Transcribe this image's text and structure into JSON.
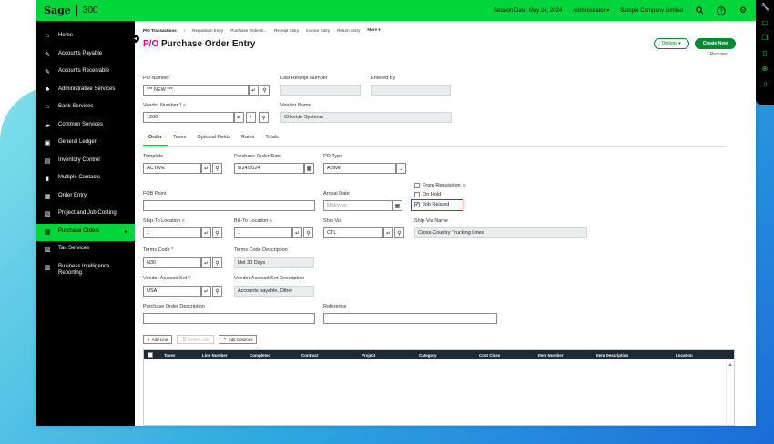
{
  "app": {
    "brand": "Sage",
    "product": "300",
    "session_date": "Session Date: May 24, 2024",
    "user": "Administrator",
    "company": "Sample Company Limited"
  },
  "sidebar": {
    "items": [
      {
        "label": "Home",
        "icon": "home-icon"
      },
      {
        "label": "Accounts Payable",
        "icon": "pen-icon"
      },
      {
        "label": "Accounts Receivable",
        "icon": "pen-icon"
      },
      {
        "label": "Administrative Services",
        "icon": "users-icon"
      },
      {
        "label": "Bank Services",
        "icon": "bank-icon"
      },
      {
        "label": "Common Services",
        "icon": "chat-icon"
      },
      {
        "label": "General Ledger",
        "icon": "ledger-icon"
      },
      {
        "label": "Inventory Control",
        "icon": "inventory-icon"
      },
      {
        "label": "Multiple Contacts",
        "icon": "contacts-icon"
      },
      {
        "label": "Order Entry",
        "icon": "order-icon"
      },
      {
        "label": "Project and Job Costing",
        "icon": "project-icon"
      },
      {
        "label": "Purchase Orders",
        "icon": "cart-icon"
      },
      {
        "label": "Tax Services",
        "icon": "tax-icon"
      },
      {
        "label": "Business Intelligence Reporting",
        "icon": "report-icon"
      }
    ]
  },
  "breadcrumb": {
    "items": [
      "P/O Transactions",
      "Requisition Entry",
      "Purchase Order E...",
      "Receipt Entry",
      "Invoice Entry",
      "Return Entry",
      "More"
    ]
  },
  "page": {
    "title_prefix": "P/O",
    "title_rest": " Purchase Order Entry",
    "options_label": "Options",
    "create_new_label": "Create New",
    "required_note": "* Required"
  },
  "form": {
    "po_number_label": "PO Number",
    "po_number_value": "*** NEW ***",
    "last_receipt_label": "Last Receipt Number",
    "entered_by_label": "Entered By",
    "vendor_number_label": "Vendor Number",
    "vendor_number_value": "1200",
    "vendor_name_label": "Vendor Name",
    "vendor_name_value": "Chloride Systems",
    "template_label": "Template",
    "template_value": "ACTIVE",
    "po_date_label": "Purchase Order Date",
    "po_date_value": "5/24/2024",
    "po_type_label": "PO Type",
    "po_type_value": "Active",
    "from_requisition_label": "From Requisition",
    "on_hold_label": "On Hold",
    "job_related_label": "Job Related",
    "fob_label": "FOB Point",
    "arrival_label": "Arrival Date",
    "arrival_placeholder": "M/d/yyyy",
    "ship_to_label": "Ship-To Location",
    "ship_to_value": "1",
    "bill_to_label": "Bill-To Location",
    "bill_to_value": "1",
    "ship_via_label": "Ship Via",
    "ship_via_value": "CTL",
    "ship_via_name_label": "Ship-Via Name",
    "ship_via_name_value": "Cross-Country Trucking Lines",
    "terms_label": "Terms Code",
    "terms_value": "N30",
    "terms_desc_label": "Terms Code Description",
    "terms_desc_value": "Net 30 Days",
    "vendor_set_label": "Vendor Account Set",
    "vendor_set_value": "USA",
    "vendor_set_desc_label": "Vendor Account Set Description",
    "vendor_set_desc_value": "Accounts payable, Other",
    "po_desc_label": "Purchase Order Description",
    "reference_label": "Reference"
  },
  "tabs": [
    "Order",
    "Taxes",
    "Optional Fields",
    "Rates",
    "Totals"
  ],
  "grid": {
    "add_line": "Add Line",
    "delete_line": "Delete Line",
    "edit_columns": "Edit Columns",
    "columns": [
      "Taxes",
      "Line Number",
      "Completed",
      "Contract",
      "Project",
      "Category",
      "Cost Class",
      "Item Number",
      "Item Description",
      "Location"
    ]
  }
}
